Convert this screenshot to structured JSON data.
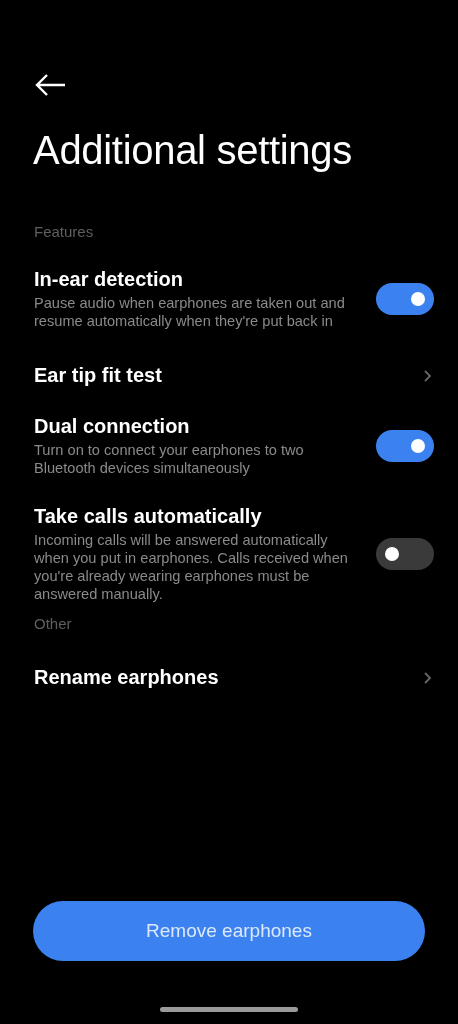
{
  "header": {
    "title": "Additional settings"
  },
  "sections": [
    {
      "heading": "Features",
      "items": [
        {
          "kind": "toggle",
          "title": "In-ear detection",
          "description": "Pause audio when earphones are taken out and resume automatically when they're put back in",
          "on": true
        },
        {
          "kind": "link",
          "title": "Ear tip fit test"
        },
        {
          "kind": "toggle",
          "title": "Dual connection",
          "description": "Turn on to connect your earphones to two Bluetooth devices simultaneously",
          "on": true
        },
        {
          "kind": "toggle",
          "title": "Take calls automatically",
          "description": "Incoming calls will be answered automatically when you put in earphones. Calls received when you're already wearing earphones must be answered manually.",
          "on": false
        }
      ]
    },
    {
      "heading": "Other",
      "items": [
        {
          "kind": "link",
          "title": "Rename earphones"
        }
      ]
    }
  ],
  "footer_button": "Remove earphones"
}
